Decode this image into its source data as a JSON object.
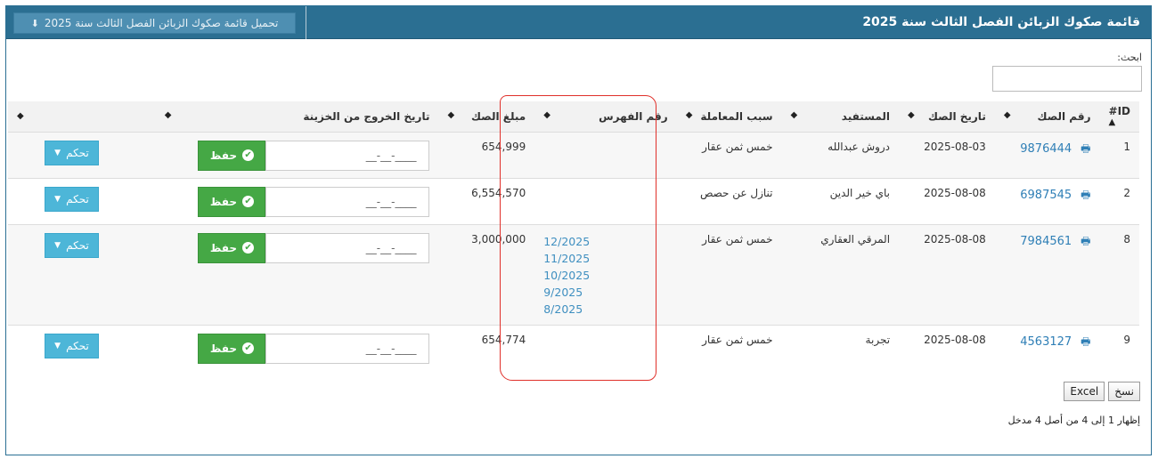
{
  "header": {
    "title": "قائمة صكوك الزبائن الفصل الثالث سنة 2025",
    "download_label": "تحميل قائمة صكوك الزبائن الفصل الثالث سنة 2025",
    "download_icon": "download-icon"
  },
  "search": {
    "label": "ابحث:",
    "value": ""
  },
  "columns": [
    "ID#",
    "رقم الصك",
    "تاريخ الصك",
    "المستفيد",
    "سبب المعاملة",
    "رقم الفهرس",
    "مبلغ الصك",
    "تاريخ الخروج من الخزينة",
    ""
  ],
  "rows": [
    {
      "id": "1",
      "number": "9876444",
      "date": "2025-08-03",
      "beneficiary": "دروش عبدالله",
      "reason": "خمس ثمن عقار",
      "index": [],
      "amount": "654,999",
      "exit_date": "__-__-____",
      "save": "حفظ",
      "control": "تحكم"
    },
    {
      "id": "2",
      "number": "6987545",
      "date": "2025-08-08",
      "beneficiary": "باي خير الدين",
      "reason": "تنازل عن حصص",
      "index": [],
      "amount": "6,554,570",
      "exit_date": "__-__-____",
      "save": "حفظ",
      "control": "تحكم"
    },
    {
      "id": "8",
      "number": "7984561",
      "date": "2025-08-08",
      "beneficiary": "المرقي العقاري",
      "reason": "خمس ثمن عقار",
      "index": [
        "12/2025",
        "11/2025",
        "10/2025",
        "9/2025",
        "8/2025"
      ],
      "amount": "3,000,000",
      "exit_date": "__-__-____",
      "save": "حفظ",
      "control": "تحكم"
    },
    {
      "id": "9",
      "number": "4563127",
      "date": "2025-08-08",
      "beneficiary": "تجربة",
      "reason": "خمس ثمن عقار",
      "index": [],
      "amount": "654,774",
      "exit_date": "__-__-____",
      "save": "حفظ",
      "control": "تحكم"
    }
  ],
  "tools": {
    "copy": "نسخ",
    "excel": "Excel"
  },
  "info": "إظهار 1 إلى 4 من أصل 4 مدخل",
  "colors": {
    "header_bg": "#2b6f92",
    "save_green": "#45a845",
    "control_blue": "#4db6d8",
    "link_blue": "#2f7fb6",
    "annotation_red": "#e0302a"
  }
}
